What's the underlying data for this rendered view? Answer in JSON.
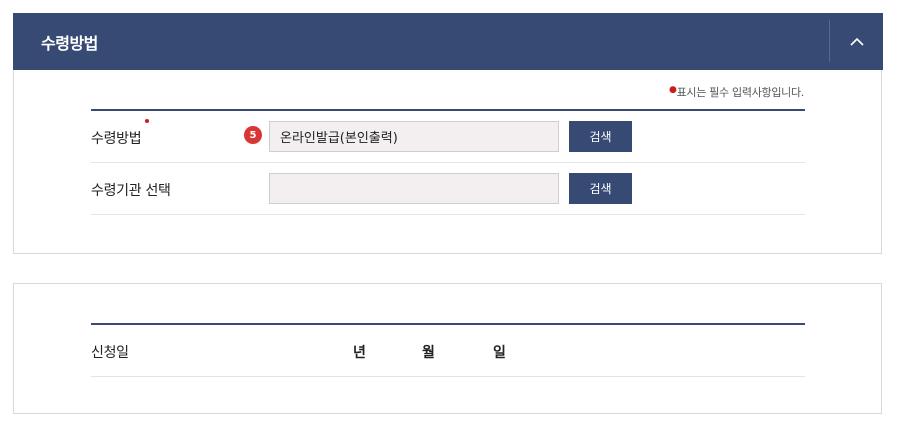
{
  "section1": {
    "title": "수령방법",
    "required_note": "표시는 필수 입력사항입니다.",
    "rows": [
      {
        "label": "수령방법",
        "badge": "5",
        "value": "온라인발급(본인출력)",
        "button": "검색"
      },
      {
        "label": "수령기관 선택",
        "value": "",
        "button": "검색"
      }
    ]
  },
  "section2": {
    "rows": [
      {
        "label": "신청일",
        "year": "년",
        "month": "월",
        "day": "일"
      }
    ]
  }
}
